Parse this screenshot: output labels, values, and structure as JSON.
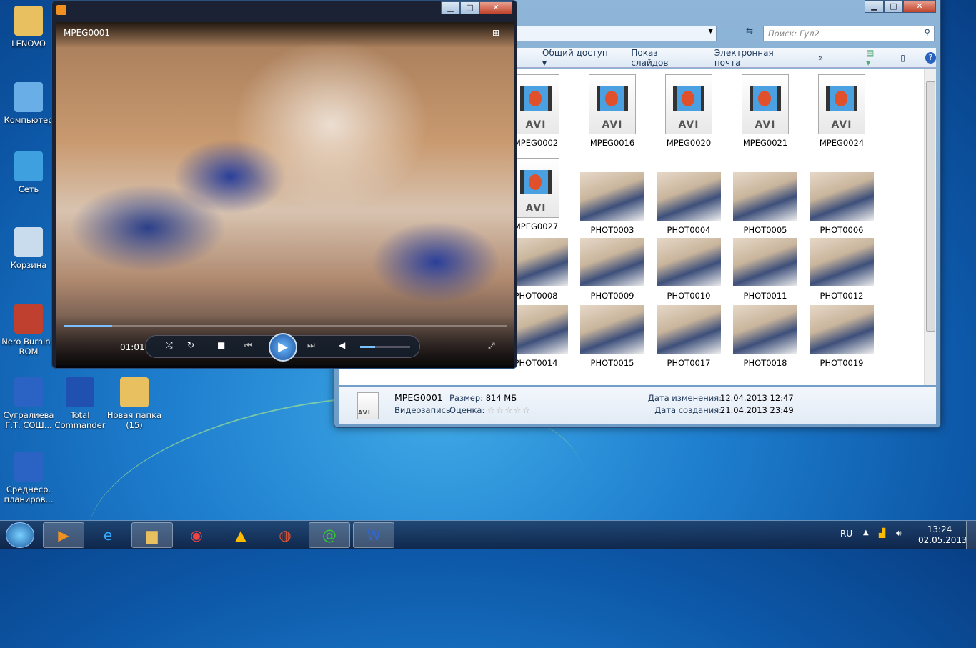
{
  "desktop": {
    "icons": [
      {
        "label": "LENOVO",
        "color": "#e8c060"
      },
      {
        "label": "Компьютер",
        "color": "#6aaee8"
      },
      {
        "label": "Сеть",
        "color": "#3fa0e0"
      },
      {
        "label": "Корзина",
        "color": "#c8dcee"
      },
      {
        "label": "Nero Burning ROM",
        "color": "#c04030"
      },
      {
        "label": "Сугралиева Г.Т. СОШ...",
        "color": "#2b63c4"
      },
      {
        "label": "Total Commander",
        "color": "#2050b0"
      },
      {
        "label": "Новая папка (15)",
        "color": "#e8c060"
      },
      {
        "label": "Среднеср. планиров...",
        "color": "#2b63c4"
      }
    ]
  },
  "player": {
    "title": "MPEG0001",
    "time": "01:01",
    "progress": 0.11,
    "volume": 0.3
  },
  "explorer": {
    "search_placeholder": "Поиск: Гул2",
    "toolbar": [
      "Общий доступ ▾",
      "Показ слайдов",
      "Электронная почта",
      "»"
    ],
    "rows": [
      [
        "MPEG0002",
        "MPEG0016",
        "MPEG0020",
        "MPEG0021",
        "MPEG0024"
      ],
      [
        "MPEG0027",
        "PHOT0003",
        "PHOT0004",
        "PHOT0005",
        "PHOT0006"
      ],
      [
        "PHOT0008",
        "PHOT0009",
        "PHOT0010",
        "PHOT0011",
        "PHOT0012"
      ],
      [
        "PHOT0014",
        "PHOT0015",
        "PHOT0017",
        "PHOT0018",
        "PHOT0019"
      ]
    ],
    "details": {
      "name": "MPEG0001",
      "type": "Видеозапись",
      "size_label": "Размер:",
      "size": "814 МБ",
      "rating_label": "Оценка:",
      "rating": 0,
      "modified_label": "Дата изменения:",
      "modified": "12.04.2013 12:47",
      "created_label": "Дата создания:",
      "created": "21.04.2013 23:49"
    }
  },
  "taskbar": {
    "lang": "RU",
    "time": "13:24",
    "date": "02.05.2013"
  }
}
